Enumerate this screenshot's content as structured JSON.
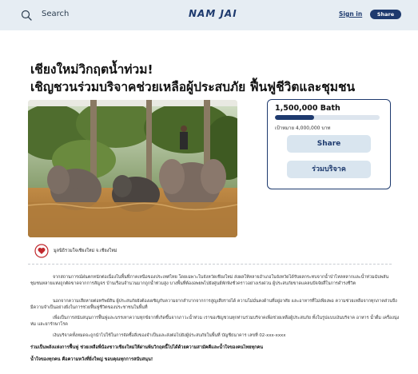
{
  "header": {
    "search_label": "Search",
    "logo_text": "NAM JAI",
    "signin_label": "Sign in",
    "share_label": "Share"
  },
  "campaign": {
    "title_line1": "เชียงใหม่วิกฤตน้ำท่วม!",
    "title_line2": "เชิญชวนร่วมบริจาคช่วยเหลือผู้ประสบภัย ฟื้นฟูชีวิตและชุมชน",
    "hero_alt": "Elephants standing in flood water"
  },
  "donation": {
    "raised": "1,500,000 Bath",
    "goal_text": "เป้าหมาย 4,000,000 บาท",
    "progress_fraction": 0.375,
    "share_button": "Share",
    "donate_button": "ร่วมบริจาค"
  },
  "organizer": {
    "name": "มูลนิธิรวมใจเชียงใหม่ จ.เชียงใหม่"
  },
  "story": {
    "p1": "จากสถานการณ์ฝนตกหนักต่อเนื่องในพื้นที่ภาคเหนือของประเทศไทย โดยเฉพาะในจังหวัดเชียงใหม่ ส่งผลให้หลายอำเภอในจังหวัดได้รับผลกระทบจากน้ำป่าไหลหลากและน้ำท่วมฉับพลัน ชุมชนหลายแห่งถูกตัดขาดจากการสัญจร บ้านเรือนจำนวนมากถูกน้ำท่วมสูง บางพื้นที่ต้องอพยพไปยังศูนย์พักพิงชั่วคราวอย่างเร่งด่วน ผู้ประสบภัยขาดแคลนปัจจัยสี่ในการดำรงชีวิต",
    "p2": "นอกจากความเสียหายต่อทรัพย์สิน ผู้ประสบภัยยังต้องเผชิญกับความยากลำบากจากการสูญเสียรายได้ ความไม่มั่นคงด้านที่อยู่อาศัย และอาหารที่ไม่เพียงพอ ความช่วยเหลือจากทุกภาคส่วนจึงมีความจำเป็นอย่างยิ่งในการช่วยฟื้นฟูชีวิตของประชาชนในพื้นที่",
    "p3": "เพื่อเป็นการสนับสนุนการฟื้นฟูและบรรเทาความทุกข์ยากที่เกิดขึ้นจากภาวะน้ำท่วม เราขอเชิญชวนทุกท่านร่วมบริจาคเพื่อช่วยเหลือผู้ประสบภัย ทั้งในรูปแบบเงินบริจาค อาหาร น้ำดื่ม เครื่องนุ่งห่ม และยารักษาโรค",
    "p4": "เงินบริจาคทั้งหมดจะถูกนำไปใช้ในการจัดซื้อสิ่งของจำเป็นและส่งต่อไปยังผู้ประสบภัยในพื้นที่ บัญชีธนาคาร เลขที่ 02-xxx-xxxx",
    "bold1": "ร่วมเป็นพลังแห่งการฟื้นฟู ช่วยเหลือพี่น้องชาวเชียงใหม่ให้ผ่านพ้นวิกฤตนี้ไปได้ด้วยความสามัคคีและน้ำใจของคนไทยทุกคน",
    "bold2": "น้ำใจของทุกคน คือความหวังที่ยิ่งใหญ่ ขอบคุณทุกการสนับสนุน!"
  },
  "colors": {
    "navy": "#1e3a6e",
    "header_bg": "#e6edf3",
    "button_bg": "#d9e5ef"
  }
}
